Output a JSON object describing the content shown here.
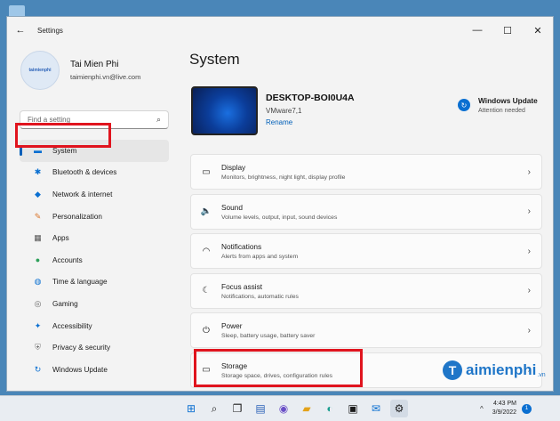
{
  "window": {
    "title": "Settings",
    "controls": {
      "minimize": "—",
      "maximize": "☐",
      "close": "✕"
    }
  },
  "profile": {
    "avatar_text": "taimienphi",
    "name": "Tai Mien Phi",
    "email": "taimienphi.vn@live.com"
  },
  "search": {
    "placeholder": "Find a setting"
  },
  "sidebar": {
    "items": [
      {
        "label": "System",
        "icon": "monitor-icon",
        "active": true
      },
      {
        "label": "Bluetooth & devices",
        "icon": "bluetooth-icon"
      },
      {
        "label": "Network & internet",
        "icon": "wifi-icon"
      },
      {
        "label": "Personalization",
        "icon": "brush-icon"
      },
      {
        "label": "Apps",
        "icon": "apps-icon"
      },
      {
        "label": "Accounts",
        "icon": "person-icon"
      },
      {
        "label": "Time & language",
        "icon": "globe-icon"
      },
      {
        "label": "Gaming",
        "icon": "gamepad-icon"
      },
      {
        "label": "Accessibility",
        "icon": "accessibility-icon"
      },
      {
        "label": "Privacy & security",
        "icon": "shield-icon"
      },
      {
        "label": "Windows Update",
        "icon": "update-icon"
      }
    ]
  },
  "main": {
    "title": "System",
    "device": {
      "name": "DESKTOP-BOI0U4A",
      "model": "VMware7,1",
      "rename": "Rename"
    },
    "windows_update": {
      "title": "Windows Update",
      "status": "Attention needed"
    },
    "cards": [
      {
        "title": "Display",
        "desc": "Monitors, brightness, night light, display profile",
        "icon": "display-icon"
      },
      {
        "title": "Sound",
        "desc": "Volume levels, output, input, sound devices",
        "icon": "speaker-icon"
      },
      {
        "title": "Notifications",
        "desc": "Alerts from apps and system",
        "icon": "bell-icon"
      },
      {
        "title": "Focus assist",
        "desc": "Notifications, automatic rules",
        "icon": "moon-icon"
      },
      {
        "title": "Power",
        "desc": "Sleep, battery usage, battery saver",
        "icon": "power-icon"
      },
      {
        "title": "Storage",
        "desc": "Storage space, drives, configuration rules",
        "icon": "storage-icon"
      }
    ]
  },
  "watermark": {
    "text": "aimienphi",
    "initial": "T",
    "suffix": ".vn"
  },
  "taskbar": {
    "clock_time": "4:43 PM",
    "clock_date": "3/9/2022",
    "notification_count": "1"
  },
  "colors": {
    "accent": "#005fb8",
    "highlight": "#e0141e",
    "desktop": "#4a86b8"
  }
}
